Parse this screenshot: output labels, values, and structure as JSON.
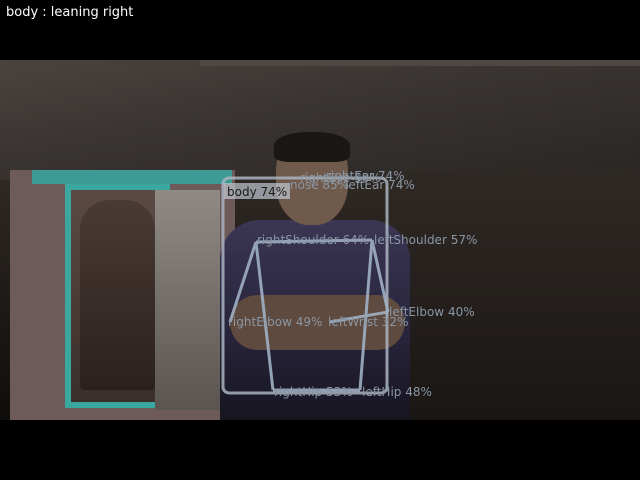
{
  "status": {
    "text": "body : leaning right"
  },
  "detection": {
    "body_label": "body 74%",
    "keypoints": {
      "nose_cluster_1": "rightEar 74%",
      "nose_cluster_2": "rightEye 58%",
      "nose_cluster_3": "nose 85%",
      "nose_cluster_4": "leftEar 74%",
      "right_shoulder": "rightShoulder 64%",
      "left_shoulder": "leftShoulder 57%",
      "right_elbow": "rightElbow 49%",
      "left_wrist": "leftWrist 32%",
      "left_elbow": "leftElbow 40%",
      "right_hip": "rightHip 53%",
      "left_hip": "leftHip 48%"
    },
    "colors": {
      "box": "#aab4c0",
      "skeleton": "#a0b0c4",
      "label": "#8a96a3"
    }
  }
}
